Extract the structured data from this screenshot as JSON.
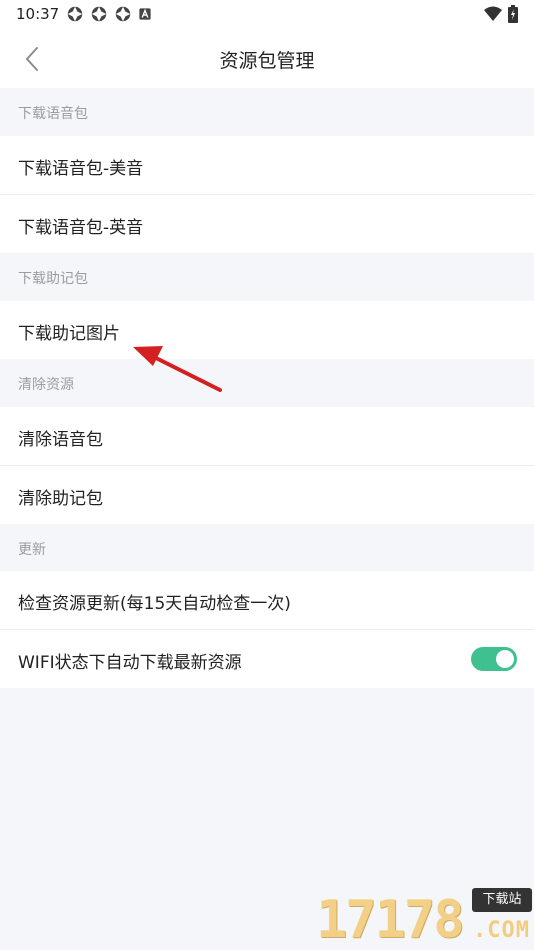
{
  "status_bar": {
    "time": "10:37",
    "left_icons": [
      "vpn-key-icon",
      "vpn-key-icon",
      "vpn-key-icon",
      "accessibility-a-icon"
    ],
    "right_icons": [
      "wifi-icon",
      "battery-charging-icon"
    ]
  },
  "app_bar": {
    "back_icon": "chevron-left-icon",
    "title": "资源包管理"
  },
  "sections": [
    {
      "header": "下载语音包",
      "items": [
        {
          "label": "下载语音包-美音"
        },
        {
          "label": "下载语音包-英音"
        }
      ]
    },
    {
      "header": "下载助记包",
      "items": [
        {
          "label": "下载助记图片"
        }
      ]
    },
    {
      "header": "清除资源",
      "items": [
        {
          "label": "清除语音包"
        },
        {
          "label": "清除助记包"
        }
      ]
    },
    {
      "header": "更新",
      "items": [
        {
          "label": "检查资源更新(每15天自动检查一次)"
        },
        {
          "label": "WIFI状态下自动下载最新资源",
          "toggle": true
        }
      ]
    }
  ],
  "colors": {
    "toggle_on": "#3fc08f",
    "annotation_arrow": "#d42020",
    "section_background": "#f5f6fa"
  },
  "annotation": {
    "type": "arrow",
    "points_to": "下载助记图片"
  },
  "watermark": {
    "digits": "17178",
    "tag": "下载站",
    "suffix": ".COM"
  }
}
